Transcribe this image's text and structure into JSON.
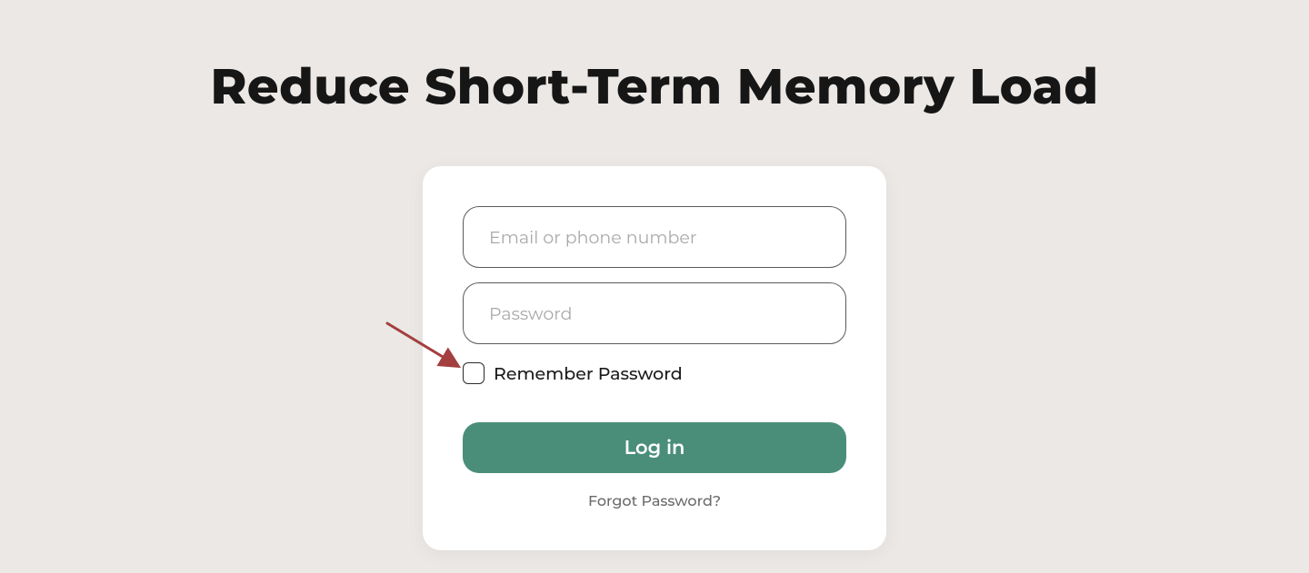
{
  "title": "Reduce Short-Term Memory Load",
  "form": {
    "email": {
      "placeholder": "Email or phone number",
      "value": ""
    },
    "password": {
      "placeholder": "Password",
      "value": ""
    },
    "remember": {
      "label": "Remember Password",
      "checked": false
    },
    "submit": {
      "label": "Log in"
    },
    "forgot": {
      "label": "Forgot Password?"
    }
  },
  "colors": {
    "background": "#ebe8e5",
    "button": "#4a8e7a",
    "arrow": "#a33f3f"
  }
}
